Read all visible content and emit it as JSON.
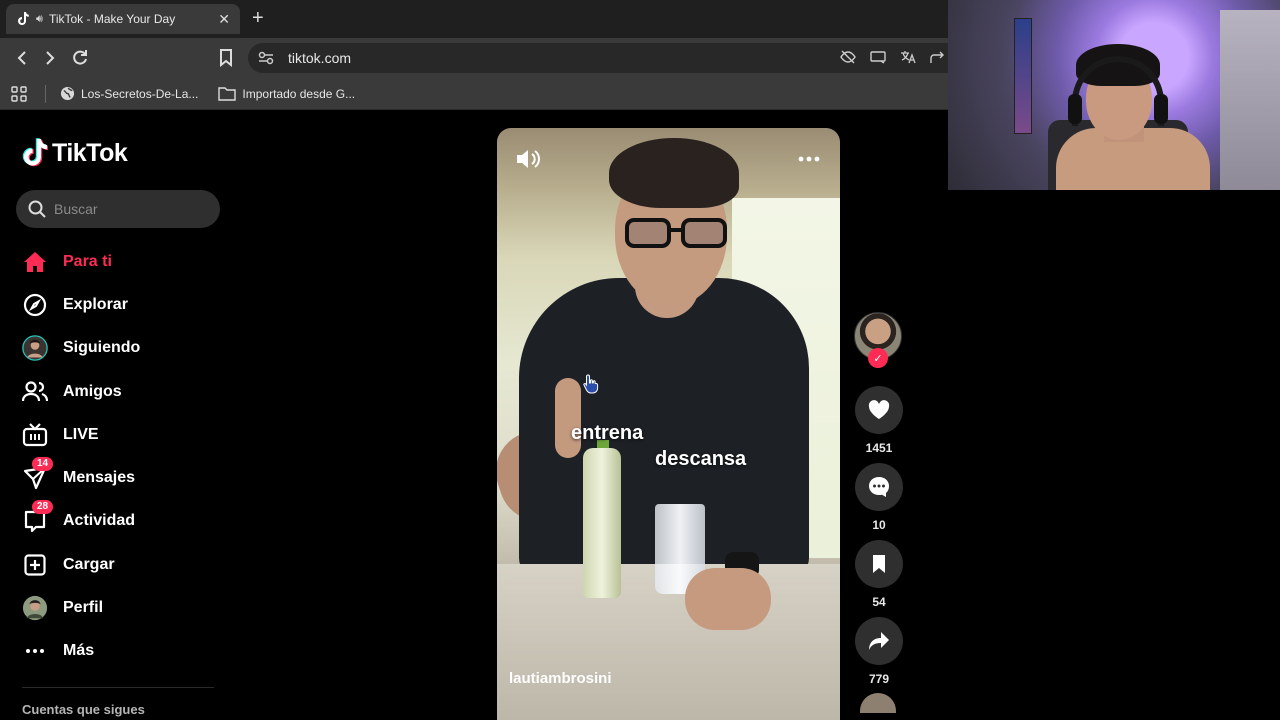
{
  "browser": {
    "tab_title": "TikTok - Make Your Day",
    "url": "tiktok.com",
    "bookmarks": [
      {
        "label": "Los-Secretos-De-La...",
        "icon": "globe-icon"
      },
      {
        "label": "Importado desde G...",
        "icon": "folder-icon"
      }
    ]
  },
  "tiktok": {
    "logo": "TikTok",
    "search": {
      "placeholder": "Buscar",
      "value": ""
    },
    "nav": [
      {
        "label": "Para ti",
        "icon": "home-icon",
        "active": true
      },
      {
        "label": "Explorar",
        "icon": "compass-icon"
      },
      {
        "label": "Siguiendo",
        "icon": "following-avatar-icon"
      },
      {
        "label": "Amigos",
        "icon": "friends-icon"
      },
      {
        "label": "LIVE",
        "icon": "live-tv-icon"
      },
      {
        "label": "Mensajes",
        "icon": "messages-icon",
        "badge": "14"
      },
      {
        "label": "Actividad",
        "icon": "activity-icon",
        "badge": "28"
      },
      {
        "label": "Cargar",
        "icon": "upload-icon"
      },
      {
        "label": "Perfil",
        "icon": "profile-avatar-icon"
      },
      {
        "label": "Más",
        "icon": "more-icon"
      }
    ],
    "following_title": "Cuentas que sigues",
    "video": {
      "overlay_text_1": "entrena",
      "overlay_text_2": "descansa",
      "author": "lautiambrosini"
    },
    "actions": {
      "likes": "1451",
      "comments": "10",
      "saves": "54",
      "shares": "779"
    },
    "colors": {
      "accent": "#fe2c55",
      "toolbar": "#3a3a3a"
    }
  }
}
